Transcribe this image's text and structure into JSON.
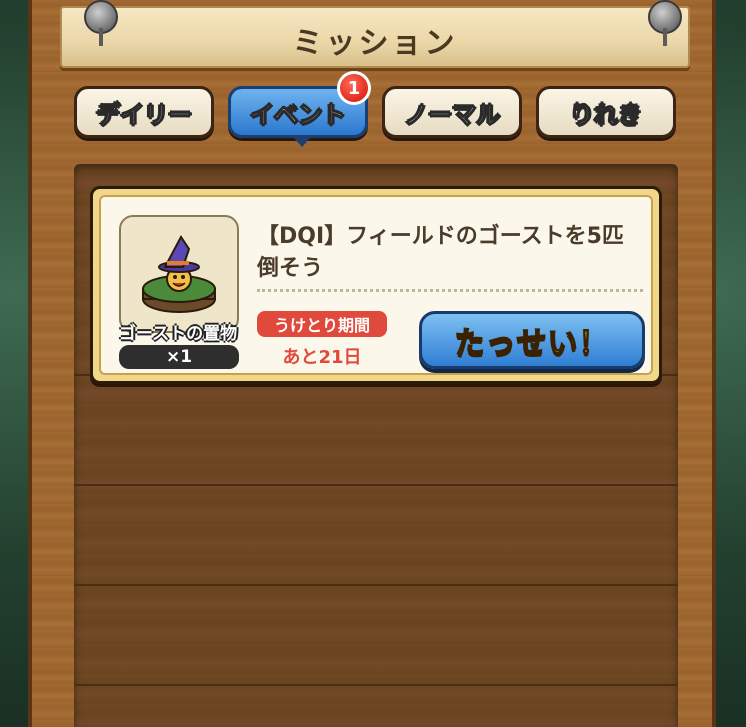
{
  "header": {
    "title": "ミッション"
  },
  "tabs": [
    {
      "label": "デイリー",
      "active": false
    },
    {
      "label": "イベント",
      "active": true,
      "badge": "1"
    },
    {
      "label": "ノーマル",
      "active": false
    },
    {
      "label": "りれき",
      "active": false
    }
  ],
  "missions": [
    {
      "title": "【DQⅠ】フィールドのゴーストを5匹倒そう",
      "reward": {
        "name": "ゴーストの置物",
        "count": "×1"
      },
      "period_label": "うけとり期間",
      "period_value": "あと21日",
      "button_label": "たっせい！"
    }
  ],
  "colors": {
    "accent_blue": "#2f7ed4",
    "badge_red": "#e02a1e",
    "period_red": "#e04a3c",
    "button_text_yellow": "#ffe340"
  }
}
